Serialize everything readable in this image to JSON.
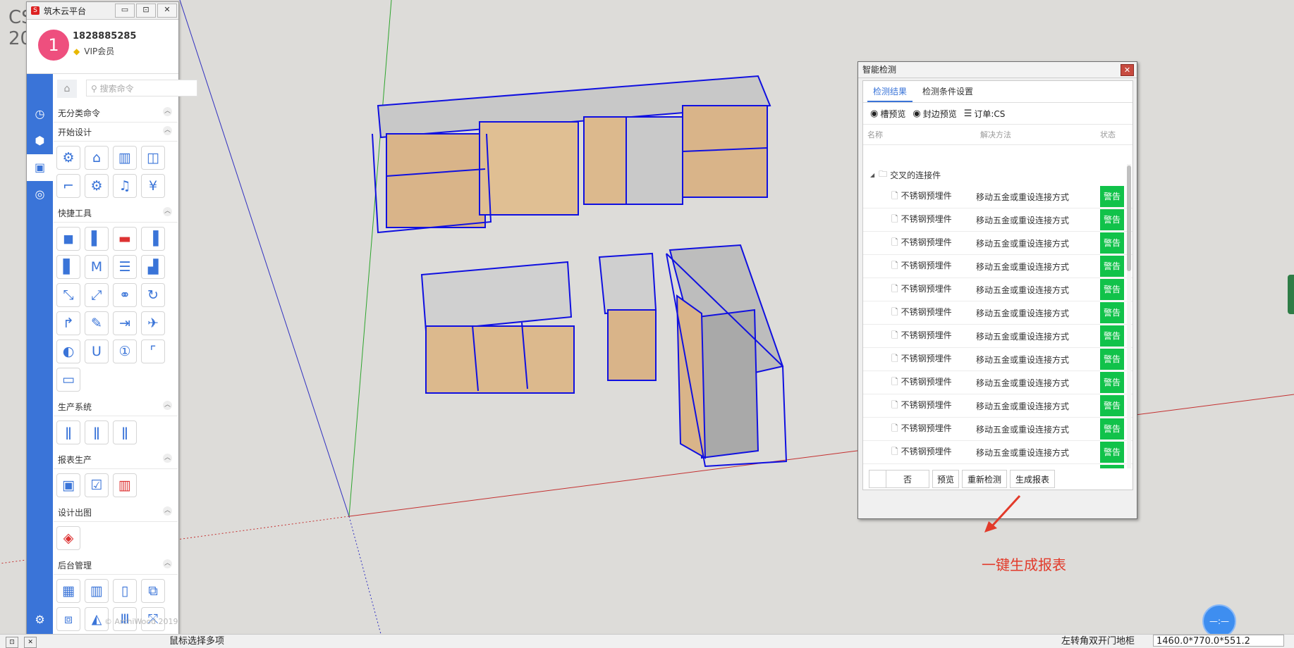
{
  "viewport": {
    "corner_text_line1": "CS",
    "corner_text_line2": "20"
  },
  "left_panel": {
    "window_title": "筑木云平台",
    "window_buttons": [
      "▭",
      "⊡",
      "✕"
    ],
    "user": {
      "avatar_initial": "1",
      "phone": "1828885285",
      "membership": "VIP会员"
    },
    "search_placeholder": "搜索命令",
    "sections": [
      {
        "title": "无分类命令",
        "tiles": []
      },
      {
        "title": "开始设计",
        "tiles": [
          "⚙",
          "⌂",
          "▥",
          "◫",
          "⌐",
          "⚙",
          "♫",
          "¥"
        ]
      },
      {
        "title": "快捷工具",
        "tiles": [
          "◼",
          "▌",
          "▬",
          "▐",
          "▋",
          "M",
          "☰",
          "▟",
          "⤡",
          "⤢",
          "⚭",
          "↻",
          "↱",
          "✎",
          "⇥",
          "✈",
          "◐",
          "U",
          "①",
          "⌜",
          "▭"
        ]
      },
      {
        "title": "生产系统",
        "tiles": [
          "ǁ",
          "ǁ",
          "ǁ"
        ]
      },
      {
        "title": "报表生产",
        "tiles": [
          "▣",
          "☑",
          "▥"
        ]
      },
      {
        "title": "设计出图",
        "tiles": [
          "◈"
        ]
      },
      {
        "title": "后台管理",
        "tiles": [
          "▦",
          "▥",
          "▯",
          "⧉",
          "⧈",
          "◭",
          "Ⅲ",
          "⤧"
        ]
      }
    ],
    "copyright": "© ArchiWood 2019"
  },
  "dialog": {
    "title": "智能检测",
    "close_label": "✕",
    "tabs": [
      "检测结果",
      "检测条件设置"
    ],
    "toolbar": {
      "preview_slot": "槽预览",
      "preview_edge": "封边预览",
      "order": "订单:CS"
    },
    "columns": {
      "name": "名称",
      "method": "解决方法",
      "status": "状态"
    },
    "group": "交叉的连接件",
    "rows": [
      {
        "name": "不锈钢预埋件",
        "method": "移动五金或重设连接方式",
        "status": "警告"
      },
      {
        "name": "不锈钢预埋件",
        "method": "移动五金或重设连接方式",
        "status": "警告"
      },
      {
        "name": "不锈钢预埋件",
        "method": "移动五金或重设连接方式",
        "status": "警告"
      },
      {
        "name": "不锈钢预埋件",
        "method": "移动五金或重设连接方式",
        "status": "警告"
      },
      {
        "name": "不锈钢预埋件",
        "method": "移动五金或重设连接方式",
        "status": "警告"
      },
      {
        "name": "不锈钢预埋件",
        "method": "移动五金或重设连接方式",
        "status": "警告"
      },
      {
        "name": "不锈钢预埋件",
        "method": "移动五金或重设连接方式",
        "status": "警告"
      },
      {
        "name": "不锈钢预埋件",
        "method": "移动五金或重设连接方式",
        "status": "警告"
      },
      {
        "name": "不锈钢预埋件",
        "method": "移动五金或重设连接方式",
        "status": "警告"
      },
      {
        "name": "不锈钢预埋件",
        "method": "移动五金或重设连接方式",
        "status": "警告"
      },
      {
        "name": "不锈钢预埋件",
        "method": "移动五金或重设连接方式",
        "status": "警告"
      },
      {
        "name": "不锈钢预埋件",
        "method": "移动五金或重设连接方式",
        "status": "警告"
      },
      {
        "name": "不锈钢预埋件",
        "method": "移动五金或重设连接方式",
        "status": "警告"
      }
    ],
    "buttons": {
      "no": "否",
      "preview": "预览",
      "recheck": "重新检测",
      "report": "生成报表"
    }
  },
  "annotation": "一键生成报表",
  "statusbar": {
    "hint": "鼠标选择多项",
    "selection": "左转角双开门地柜",
    "dimensions": "1460.0*770.0*551.2"
  },
  "nav_widget_label": "—:—",
  "colors": {
    "accent": "#3a74d8",
    "status_ok": "#11c24a",
    "annotation": "#e23a2a",
    "avatar": "#ee4f7e"
  }
}
